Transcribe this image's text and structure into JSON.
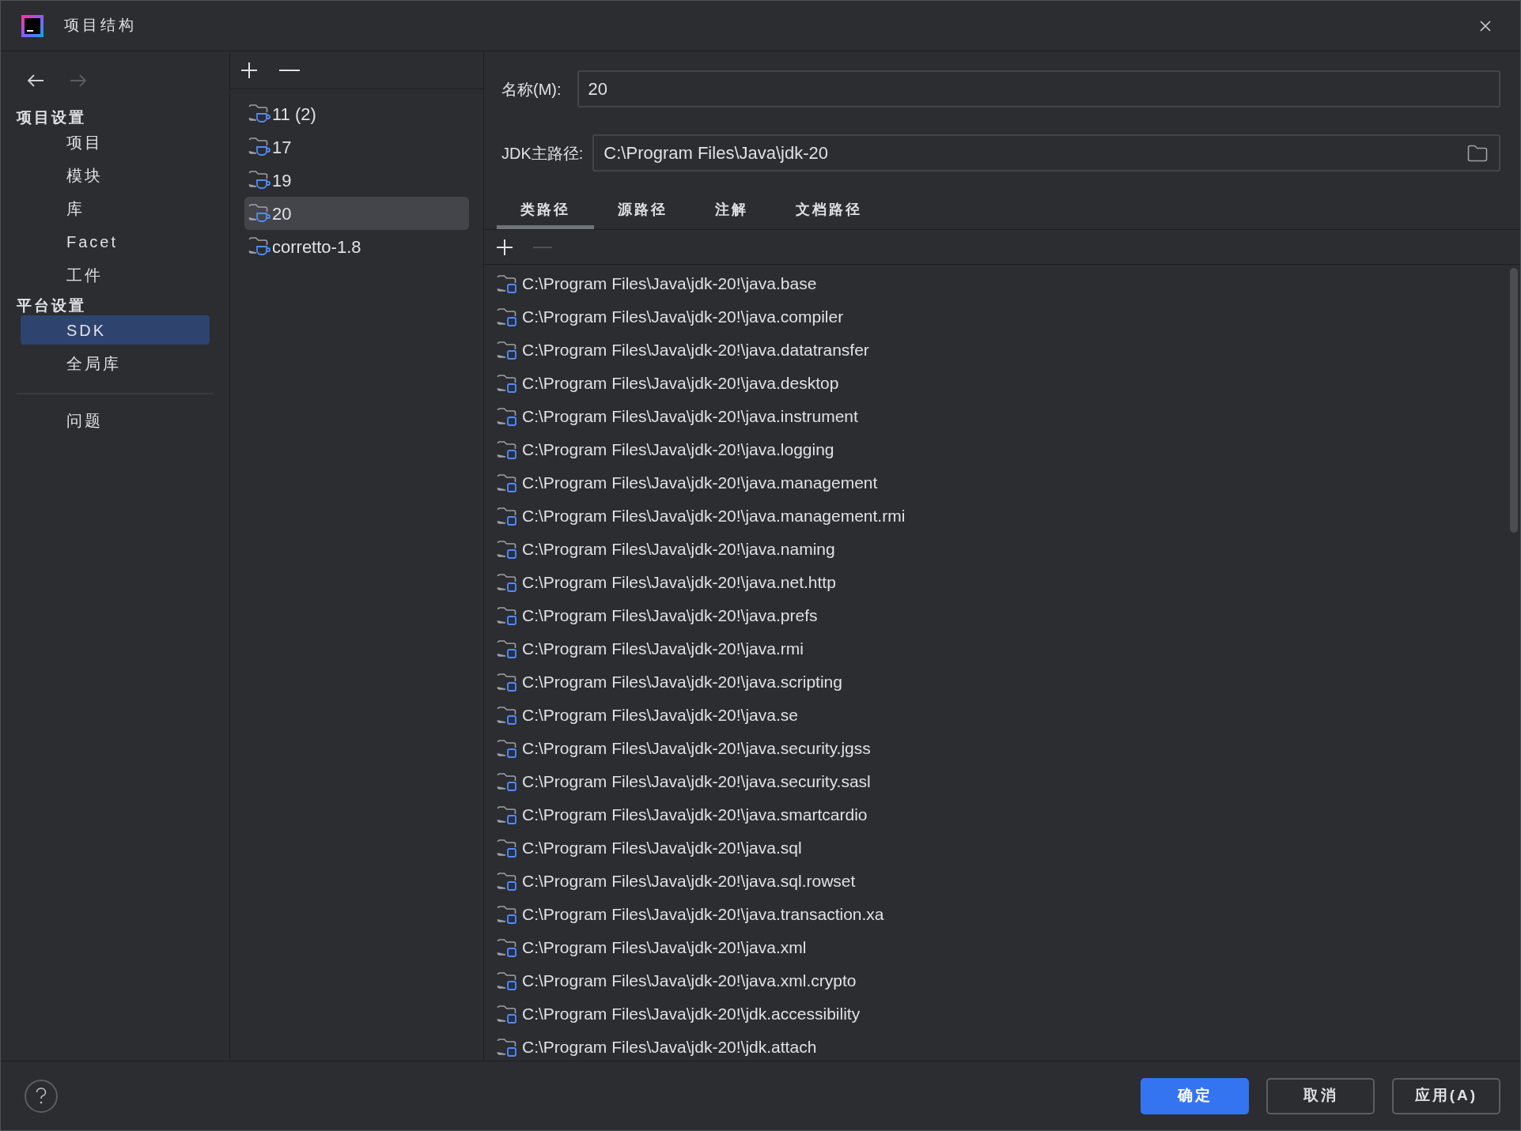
{
  "window": {
    "title": "项目结构"
  },
  "navigation": {
    "back": {
      "disabled": false
    },
    "forward": {
      "disabled": true
    }
  },
  "sidebar": {
    "sections": [
      {
        "header": "项目设置",
        "items": [
          {
            "label": "项目",
            "selected": false
          },
          {
            "label": "模块",
            "selected": false
          },
          {
            "label": "库",
            "selected": false
          },
          {
            "label": "Facet",
            "selected": false
          },
          {
            "label": "工件",
            "selected": false
          }
        ]
      },
      {
        "header": "平台设置",
        "items": [
          {
            "label": "SDK",
            "selected": true
          },
          {
            "label": "全局库",
            "selected": false
          }
        ]
      },
      {
        "items": [
          {
            "label": "问题",
            "selected": false
          }
        ]
      }
    ]
  },
  "sdk_list": {
    "remove_disabled": false,
    "items": [
      {
        "label": "11 (2)",
        "selected": false
      },
      {
        "label": "17",
        "selected": false
      },
      {
        "label": "19",
        "selected": false
      },
      {
        "label": "20",
        "selected": true
      },
      {
        "label": "corretto-1.8",
        "selected": false
      }
    ]
  },
  "name_field": {
    "label": "名称(M):",
    "value": "20"
  },
  "jdk_home_field": {
    "label": "JDK主路径:",
    "value": "C:\\Program Files\\Java\\jdk-20"
  },
  "tabs": [
    {
      "label": "类路径",
      "selected": true
    },
    {
      "label": "源路径",
      "selected": false
    },
    {
      "label": "注解",
      "selected": false
    },
    {
      "label": "文档路径",
      "selected": false
    }
  ],
  "classpath_list": {
    "remove_disabled": true,
    "items": [
      "C:\\Program Files\\Java\\jdk-20!\\java.base",
      "C:\\Program Files\\Java\\jdk-20!\\java.compiler",
      "C:\\Program Files\\Java\\jdk-20!\\java.datatransfer",
      "C:\\Program Files\\Java\\jdk-20!\\java.desktop",
      "C:\\Program Files\\Java\\jdk-20!\\java.instrument",
      "C:\\Program Files\\Java\\jdk-20!\\java.logging",
      "C:\\Program Files\\Java\\jdk-20!\\java.management",
      "C:\\Program Files\\Java\\jdk-20!\\java.management.rmi",
      "C:\\Program Files\\Java\\jdk-20!\\java.naming",
      "C:\\Program Files\\Java\\jdk-20!\\java.net.http",
      "C:\\Program Files\\Java\\jdk-20!\\java.prefs",
      "C:\\Program Files\\Java\\jdk-20!\\java.rmi",
      "C:\\Program Files\\Java\\jdk-20!\\java.scripting",
      "C:\\Program Files\\Java\\jdk-20!\\java.se",
      "C:\\Program Files\\Java\\jdk-20!\\java.security.jgss",
      "C:\\Program Files\\Java\\jdk-20!\\java.security.sasl",
      "C:\\Program Files\\Java\\jdk-20!\\java.smartcardio",
      "C:\\Program Files\\Java\\jdk-20!\\java.sql",
      "C:\\Program Files\\Java\\jdk-20!\\java.sql.rowset",
      "C:\\Program Files\\Java\\jdk-20!\\java.transaction.xa",
      "C:\\Program Files\\Java\\jdk-20!\\java.xml",
      "C:\\Program Files\\Java\\jdk-20!\\java.xml.crypto",
      "C:\\Program Files\\Java\\jdk-20!\\jdk.accessibility",
      "C:\\Program Files\\Java\\jdk-20!\\jdk.attach"
    ]
  },
  "buttons": [
    {
      "label": "确定",
      "kind": "primary"
    },
    {
      "label": "取消",
      "kind": "secondary"
    },
    {
      "label": "应用(A)",
      "kind": "secondary"
    }
  ]
}
